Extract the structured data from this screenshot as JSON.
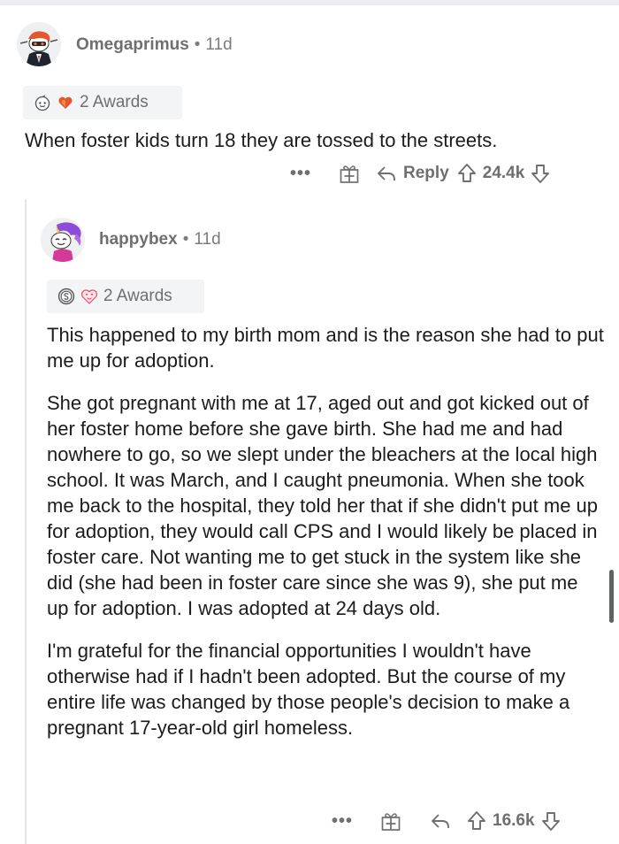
{
  "comments": [
    {
      "username": "Omegaprimus",
      "separator": "•",
      "age": "11d",
      "awards_label": "2 Awards",
      "body": [
        "When foster kids turn 18 they are tossed to the streets."
      ],
      "reply_label": "Reply",
      "score": "24.4k",
      "more_label": "•••"
    },
    {
      "username": "happybex",
      "separator": "•",
      "age": "11d",
      "awards_label": "2 Awards",
      "body": [
        "This happened to my birth mom and is the reason she had to put me up for adoption.",
        "She got pregnant with me at 17, aged out and got kicked out of her foster home before she gave birth. She had me and had nowhere to go, so we slept under the bleachers at the local high school. It was March, and I caught pneumonia. When she took me back to the hospital, they told her that if she didn't put me up for adoption, they would call CPS and I would likely be placed in foster care. Not wanting me to get stuck in the system like she did (she had been in foster care since she was 9), she put me up for adoption. I was adopted at 24 days old.",
        "I'm grateful for the financial opportunities I wouldn't have otherwise had if I hadn't been adopted. But the course of my entire life was changed by those people's decision to make a pregnant 17-year-old girl homeless."
      ],
      "score": "16.6k",
      "more_label": "•••"
    }
  ],
  "icons": {
    "avatar_1": "avatar-robot-snoo",
    "avatar_2": "avatar-unicorn-snoo",
    "award_1a": "snoo-face-award-icon",
    "award_1b": "heart-award-icon",
    "award_2a": "silver-award-icon",
    "award_2b": "heart-eyes-award-icon",
    "give_award": "gift-icon",
    "reply": "reply-arrow-icon",
    "upvote": "upvote-arrow-icon",
    "downvote": "downvote-arrow-icon"
  },
  "colors": {
    "text": "#1c1c1c",
    "meta": "#7c7c7c",
    "award_bg": "#f3f4f5",
    "thread_line": "#e4e5e7",
    "heart_orange": "#e4572e",
    "avatar_pink": "#d43a9a",
    "avatar_purple": "#8c4bd8"
  }
}
